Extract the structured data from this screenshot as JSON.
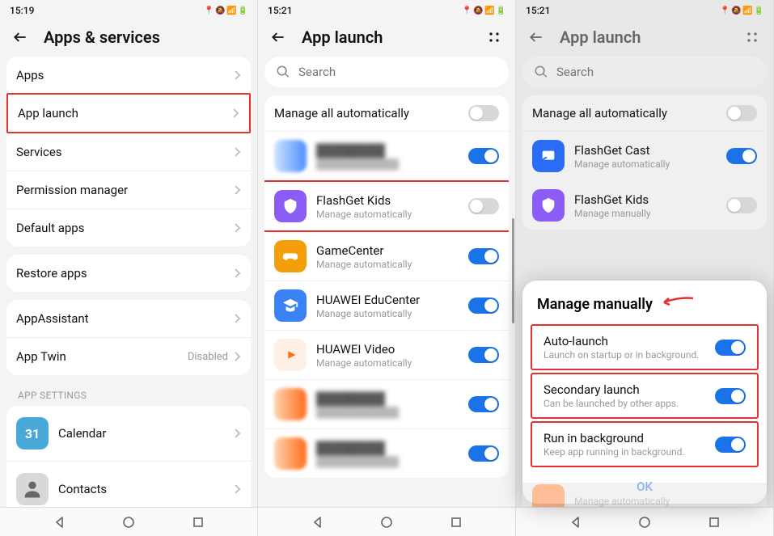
{
  "screen1": {
    "time": "15:19",
    "title": "Apps & services",
    "rows": {
      "apps": "Apps",
      "applaunch": "App launch",
      "services": "Services",
      "permission": "Permission manager",
      "defaultapps": "Default apps",
      "restore": "Restore apps",
      "assistant": "AppAssistant",
      "twin": "App Twin",
      "twin_value": "Disabled"
    },
    "section": "APP SETTINGS",
    "calendar": "Calendar",
    "calendar_day": "31",
    "contacts": "Contacts"
  },
  "screen2": {
    "time": "15:21",
    "title": "App launch",
    "search_placeholder": "Search",
    "manage_all": "Manage all automatically",
    "apps": {
      "kids": {
        "name": "FlashGet Kids",
        "sub": "Manage automatically"
      },
      "game": {
        "name": "GameCenter",
        "sub": "Manage automatically"
      },
      "edu": {
        "name": "HUAWEI EduCenter",
        "sub": "Manage automatically"
      },
      "video": {
        "name": "HUAWEI Video",
        "sub": "Manage automatically"
      }
    }
  },
  "screen3": {
    "time": "15:21",
    "title": "App launch",
    "search_placeholder": "Search",
    "manage_all": "Manage all automatically",
    "apps": {
      "cast": {
        "name": "FlashGet Cast",
        "sub": "Manage automatically"
      },
      "kids": {
        "name": "FlashGet Kids",
        "sub": "Manage manually"
      },
      "hidden": {
        "sub": "Manage automatically"
      }
    },
    "dialog": {
      "title": "Manage manually",
      "auto": {
        "t": "Auto-launch",
        "d": "Launch on startup or in background."
      },
      "secondary": {
        "t": "Secondary launch",
        "d": "Can be launched by other apps."
      },
      "bg": {
        "t": "Run in background",
        "d": "Keep app running in background."
      },
      "ok": "OK"
    }
  }
}
